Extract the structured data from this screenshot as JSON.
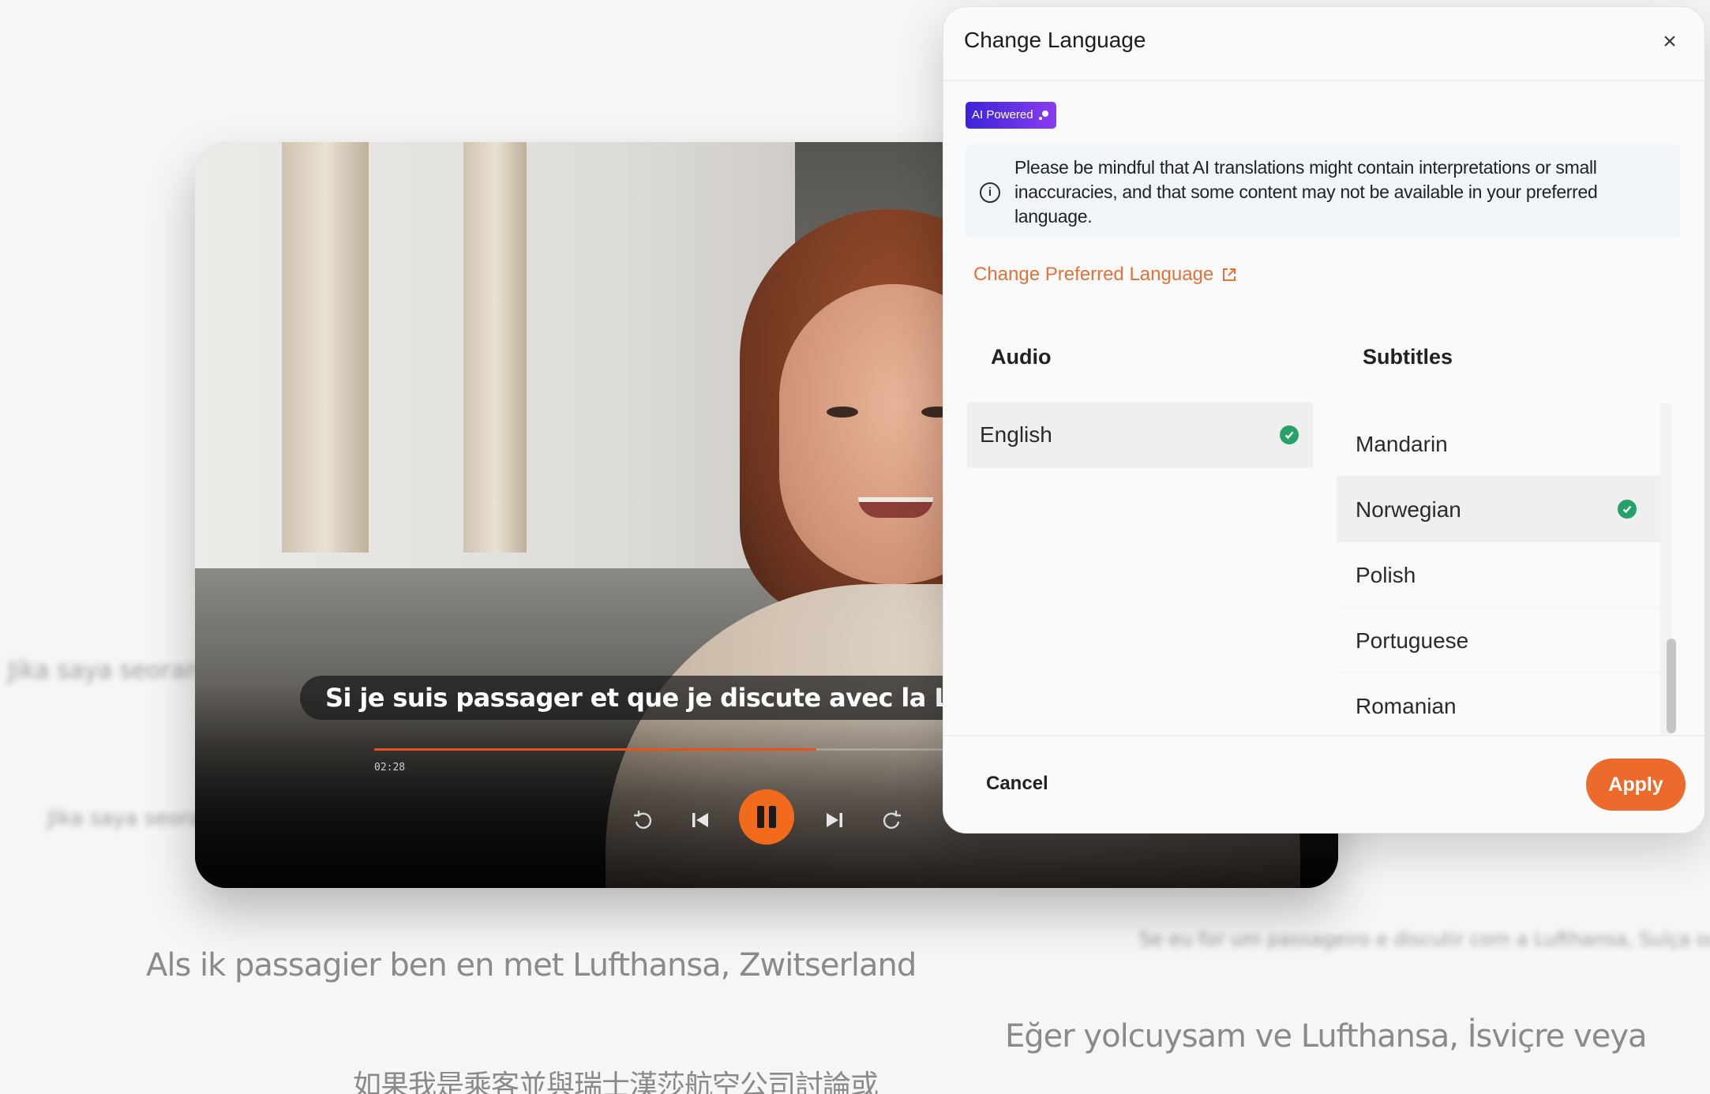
{
  "background_captions": {
    "left_faded": "Jika saya seorang",
    "left_top_faded": "Jika saya seorang penumpang dan",
    "right_faded": "Se eu for um passageiro e discutir com a Lufthansa, Suíça ou",
    "dutch": "Als ik passagier ben en met Lufthansa, Zwitserland",
    "turkish": "Eğer yolcuysam ve Lufthansa, İsviçre veya",
    "chinese": "如果我是乘客並與瑞士漢莎航空公司討論或"
  },
  "player": {
    "subtitle": "Si je suis passager et que je discute avec la Lufthansa",
    "time": "02:28",
    "progress_fraction": 0.56,
    "controls": {
      "replay_icon": "replay-10-icon",
      "prev_icon": "skip-previous-icon",
      "pause_icon": "pause-icon",
      "next_icon": "skip-next-icon",
      "forward_icon": "forward-10-icon"
    },
    "accent_color": "#f26a1b"
  },
  "modal": {
    "title": "Change Language",
    "close_label": "×",
    "badge": "AI Powered",
    "notice": "Please be mindful that AI translations might contain interpretations or small inaccuracies, and that some content may not be available in your preferred language.",
    "preferred_link": "Change Preferred Language",
    "audio": {
      "heading": "Audio",
      "items": [
        {
          "label": "English",
          "selected": true
        }
      ]
    },
    "subtitles": {
      "heading": "Subtitles",
      "items": [
        {
          "label": "Mandarin",
          "selected": false
        },
        {
          "label": "Norwegian",
          "selected": true
        },
        {
          "label": "Polish",
          "selected": false
        },
        {
          "label": "Portuguese",
          "selected": false
        },
        {
          "label": "Romanian",
          "selected": false
        }
      ]
    },
    "cancel_label": "Cancel",
    "apply_label": "Apply",
    "apply_color": "#ec6a2b",
    "link_color": "#e2713a",
    "check_color": "#26a269"
  }
}
